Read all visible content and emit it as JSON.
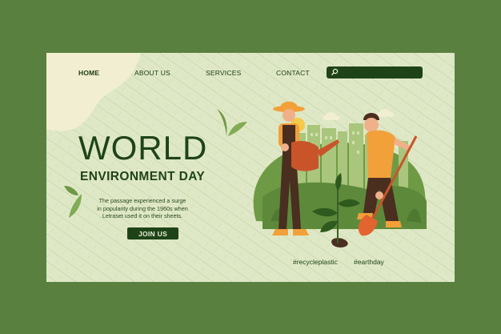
{
  "nav": {
    "items": [
      {
        "label": "HOME",
        "active": true
      },
      {
        "label": "ABOUT US",
        "active": false
      },
      {
        "label": "SERVICES",
        "active": false
      },
      {
        "label": "CONTACT",
        "active": false
      }
    ],
    "search": {
      "placeholder": "",
      "icon": "search-icon"
    }
  },
  "hero": {
    "title": "WORLD",
    "subtitle": "ENVIRONMENT DAY",
    "description": "The passage experienced a surge in popularity during the 1960s when Letraset used it on their sheets.",
    "cta_label": "JOIN US"
  },
  "tags": [
    "#recycleplastic",
    "#earthday"
  ],
  "colors": {
    "page_bg": "#5a8040",
    "card_bg": "#dfe8c6",
    "accent_dark": "#1f4318",
    "orange": "#f2a03a",
    "brown": "#4a2e20"
  }
}
